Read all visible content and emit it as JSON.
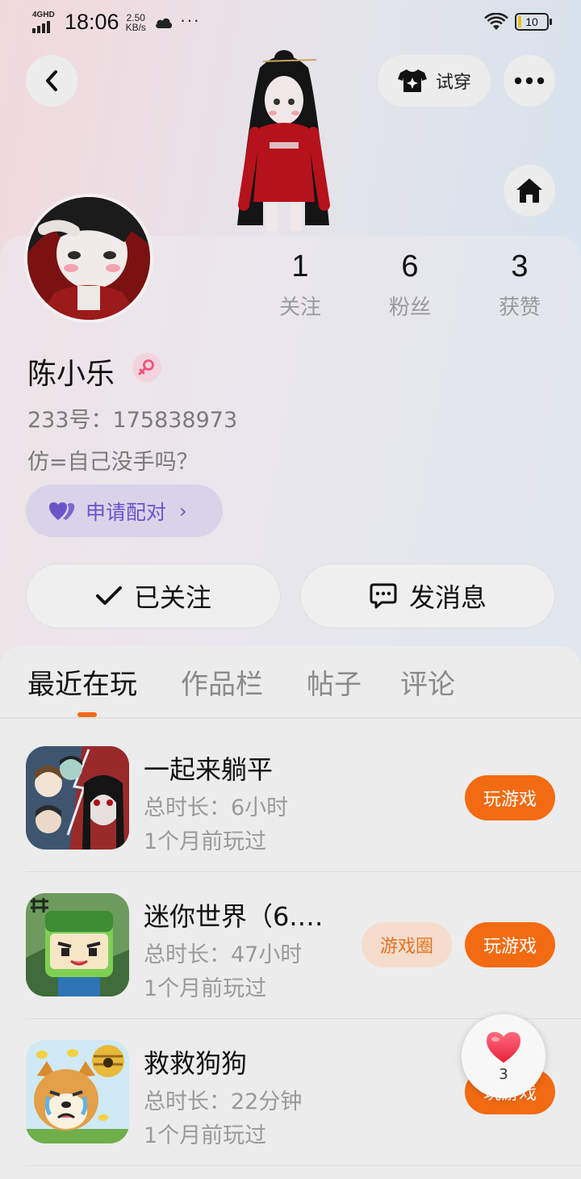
{
  "status_bar": {
    "network": "4GHD",
    "time": "18:06",
    "speed_value": "2.50",
    "speed_unit": "KB/s",
    "more": "···",
    "battery": "10"
  },
  "header": {
    "tryon_label": "试穿"
  },
  "profile": {
    "name": "陈小乐",
    "uid": "233号：175838973",
    "bio": "仿=自己没手吗？",
    "match_label": "申请配对",
    "stats": [
      {
        "num": "1",
        "label": "关注"
      },
      {
        "num": "6",
        "label": "粉丝"
      },
      {
        "num": "3",
        "label": "获赞"
      }
    ],
    "follow_label": "已关注",
    "message_label": "发消息"
  },
  "tabs": [
    {
      "label": "最近在玩",
      "active": true
    },
    {
      "label": "作品栏",
      "active": false
    },
    {
      "label": "帖子",
      "active": false
    },
    {
      "label": "评论",
      "active": false
    }
  ],
  "games": [
    {
      "name": "一起来躺平",
      "duration": "总时长：6小时",
      "last_played": "1个月前玩过",
      "play_label": "玩游戏"
    },
    {
      "name": "迷你世界（6.…",
      "duration": "总时长：47小时",
      "last_played": "1个月前玩过",
      "play_label": "玩游戏",
      "circle_label": "游戏圈"
    },
    {
      "name": "救救狗狗",
      "duration": "总时长：22分钟",
      "last_played": "1个月前玩过",
      "play_label": "玩游戏"
    }
  ],
  "like_float": {
    "count": "3"
  },
  "colors": {
    "accent": "#f26b12",
    "match_purple": "#6a55c8",
    "heart": "#f0485c"
  }
}
